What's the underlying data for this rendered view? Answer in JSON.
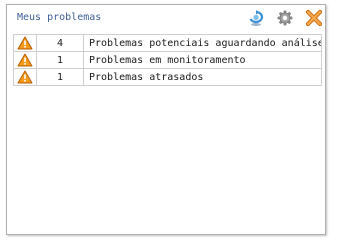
{
  "panel": {
    "title": "Meus problemas",
    "buttons": {
      "refresh_icon": "refresh-icon",
      "config_icon": "gear-icon",
      "close_icon": "close-icon"
    }
  },
  "problems": {
    "rows": [
      {
        "icon": "warning-icon",
        "count": "4",
        "label": "Problemas potenciais aguardando análise"
      },
      {
        "icon": "warning-icon",
        "count": "1",
        "label": "Problemas em monitoramento"
      },
      {
        "icon": "warning-icon",
        "count": "1",
        "label": "Problemas atrasados"
      }
    ]
  },
  "colors": {
    "title": "#3c5f96",
    "warning_fill": "#f59a1b",
    "close_orange": "#f08a1c",
    "refresh_blue": "#3a8fd6"
  }
}
